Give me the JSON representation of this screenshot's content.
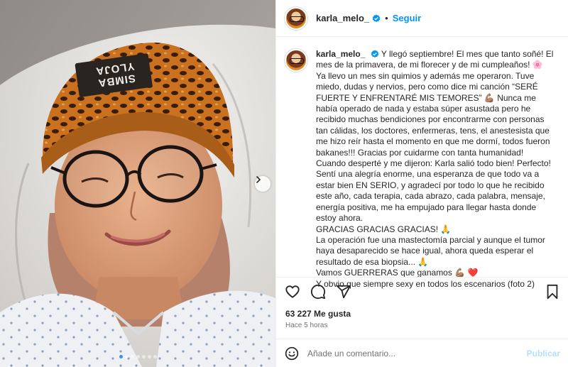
{
  "post": {
    "username": "karla_melo_",
    "separator": "•",
    "follow_label": "Seguir",
    "caption": {
      "username": "karla_melo_",
      "lines": [
        "Y llegó septiembre! El mes que tanto soñé! El mes de la primavera, de mi florecer y de mi cumpleaños! 🌸",
        "Ya llevo un mes sin quimios y además me operaron. Tuve miedo, dudas y nervios, pero como dice mi canción “SERÉ FUERTE Y ENFRENTARÉ MIS TEMORES” 💪🏽 Nunca me había operado de nada y estaba súper asustada pero he recibido muchas bendiciones por encontrarme con personas tan cálidas, los doctores, enfermeras, tens, el anestesista que me hizo reír hasta el momento en que me dormí, todos fueron bakanes!!! Gracias por cuidarme con tanta humanidad!",
        "Cuando desperté y me dijeron: Karla salió todo bien! Perfecto! Sentí una alegría enorme, una esperanza de que todo va a estar bien EN SERIO, y agradecí por todo lo que he recibido este año, cada terapia, cada abrazo, cada palabra, mensaje, energía positiva, me ha empujado para llegar hasta donde estoy ahora.",
        "GRACIAS GRACIAS GRACIAS! 🙏",
        "La operación fue una mastectomía parcial y aunque el tumor haya desaparecido se hace igual, ahora queda esperar el resultado de esa biopsia... 🙏",
        "Vamos GUERRERAS que ganamos 💪🏽 ❤️",
        "Y obvio que siempre sexy en todos los escenarios (foto 2)"
      ]
    },
    "likes": "63 227 Me gusta",
    "time_ago": "Hace 5 horas",
    "comment_placeholder": "Añade un comentario...",
    "publish_label": "Publicar",
    "beanie_text": [
      "SIMBA",
      "YLOJA"
    ],
    "carousel": {
      "count": 7,
      "active": 0
    },
    "colors": {
      "accent": "#0095f6",
      "verified": "#0095f6",
      "publish_disabled": "#b2dffc",
      "carousel_dot_active": "#3c8cff"
    },
    "icons": [
      "chevron-right-icon",
      "verified-icon",
      "heart-icon",
      "comment-icon",
      "share-icon",
      "bookmark-icon",
      "emoji-icon"
    ]
  }
}
